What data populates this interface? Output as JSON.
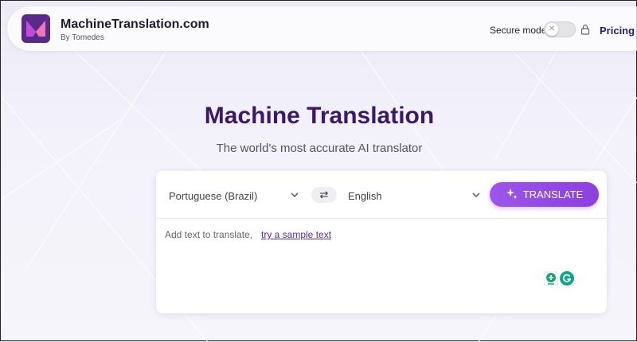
{
  "header": {
    "brand": "MachineTranslation.com",
    "byline": "By Tomedes",
    "secure_mode_label": "Secure mode",
    "secure_mode_on": false,
    "pricing": "Pricing"
  },
  "hero": {
    "title": "Machine Translation",
    "subtitle": "The world's most accurate AI translator"
  },
  "translator": {
    "source_language": "Portuguese (Brazil)",
    "target_language": "English",
    "swap_icon": "swap-arrows-icon",
    "translate_label": "TRANSLATE",
    "placeholder_text": "Add text to translate,",
    "sample_link": "try a sample text"
  },
  "colors": {
    "title": "#3a1a66",
    "accent": "#8b3fe0",
    "link": "#5b2a9e"
  }
}
